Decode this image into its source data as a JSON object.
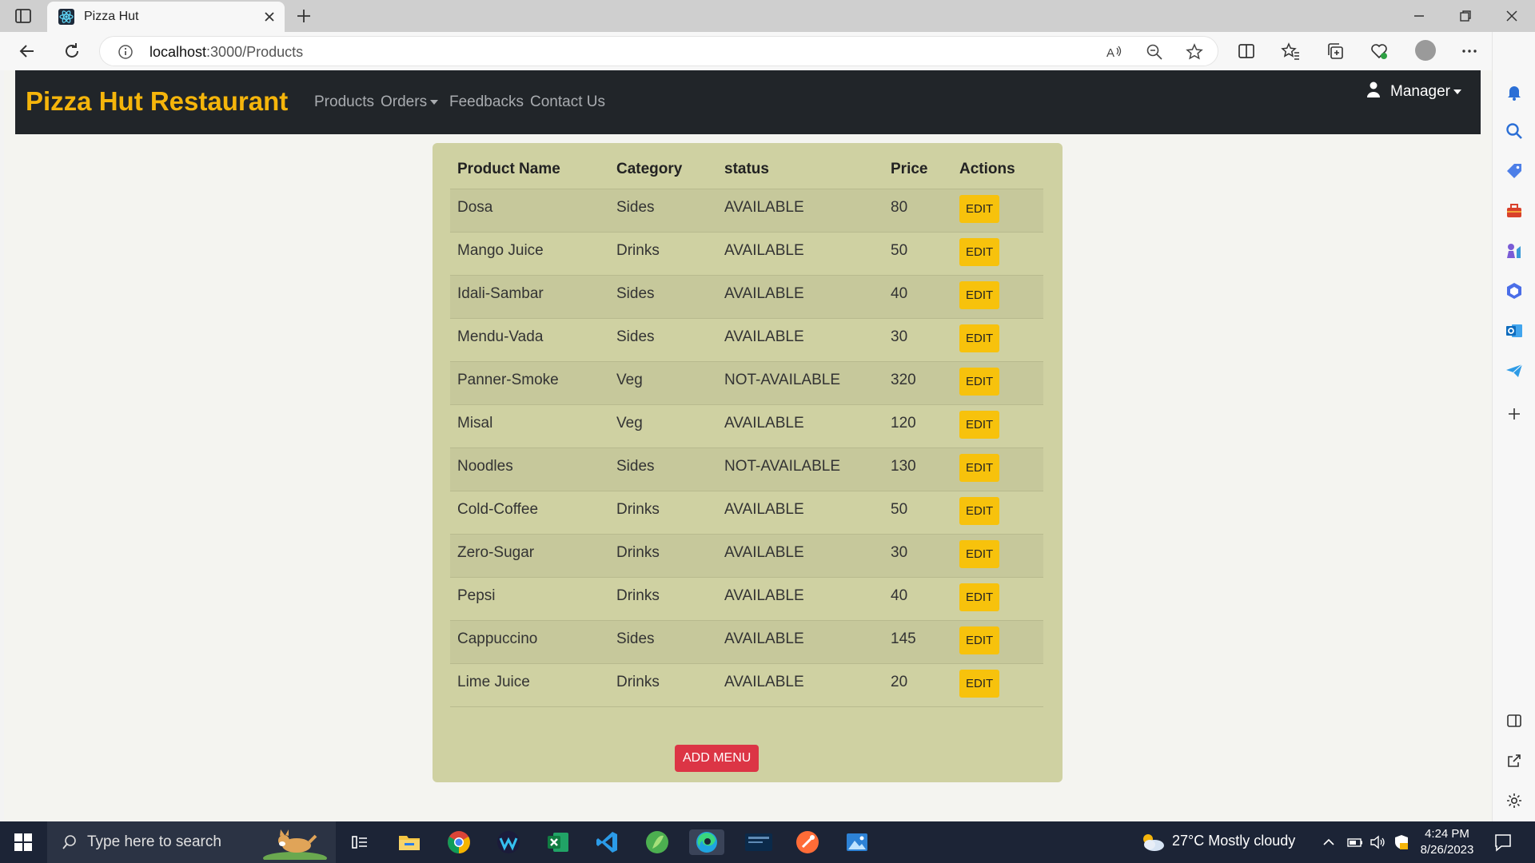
{
  "browser": {
    "tab_title": "Pizza Hut",
    "url_host": "localhost",
    "url_path": ":3000/Products"
  },
  "navbar": {
    "brand": "Pizza Hut Restaurant",
    "links": [
      "Products",
      "Orders",
      "Feedbacks",
      "Contact Us"
    ],
    "user_menu": "Manager"
  },
  "table": {
    "headers": [
      "Product Name",
      "Category",
      "status",
      "Price",
      "Actions"
    ],
    "rows": [
      {
        "name": "Dosa",
        "category": "Sides",
        "status": "AVAILABLE",
        "price": "80"
      },
      {
        "name": "Mango Juice",
        "category": "Drinks",
        "status": "AVAILABLE",
        "price": "50"
      },
      {
        "name": "Idali-Sambar",
        "category": "Sides",
        "status": "AVAILABLE",
        "price": "40"
      },
      {
        "name": "Mendu-Vada",
        "category": "Sides",
        "status": "AVAILABLE",
        "price": "30"
      },
      {
        "name": "Panner-Smoke",
        "category": "Veg",
        "status": "NOT-AVAILABLE",
        "price": "320"
      },
      {
        "name": "Misal",
        "category": "Veg",
        "status": "AVAILABLE",
        "price": "120"
      },
      {
        "name": "Noodles",
        "category": "Sides",
        "status": "NOT-AVAILABLE",
        "price": "130"
      },
      {
        "name": "Cold-Coffee",
        "category": "Drinks",
        "status": "AVAILABLE",
        "price": "50"
      },
      {
        "name": "Zero-Sugar",
        "category": "Drinks",
        "status": "AVAILABLE",
        "price": "30"
      },
      {
        "name": "Pepsi",
        "category": "Drinks",
        "status": "AVAILABLE",
        "price": "40"
      },
      {
        "name": "Cappuccino",
        "category": "Sides",
        "status": "AVAILABLE",
        "price": "145"
      },
      {
        "name": "Lime Juice",
        "category": "Drinks",
        "status": "AVAILABLE",
        "price": "20"
      }
    ],
    "edit_label": "EDIT"
  },
  "add_menu_label": "ADD MENU",
  "taskbar": {
    "search_placeholder": "Type here to search",
    "weather": "27°C  Mostly cloudy",
    "time": "4:24 PM",
    "date": "8/26/2023"
  },
  "colors": {
    "brand": "#f5b50b",
    "navbar_bg": "#212529",
    "card_bg": "#cfd1a2",
    "edit_btn": "#f7c20c",
    "add_btn": "#dc3545"
  }
}
